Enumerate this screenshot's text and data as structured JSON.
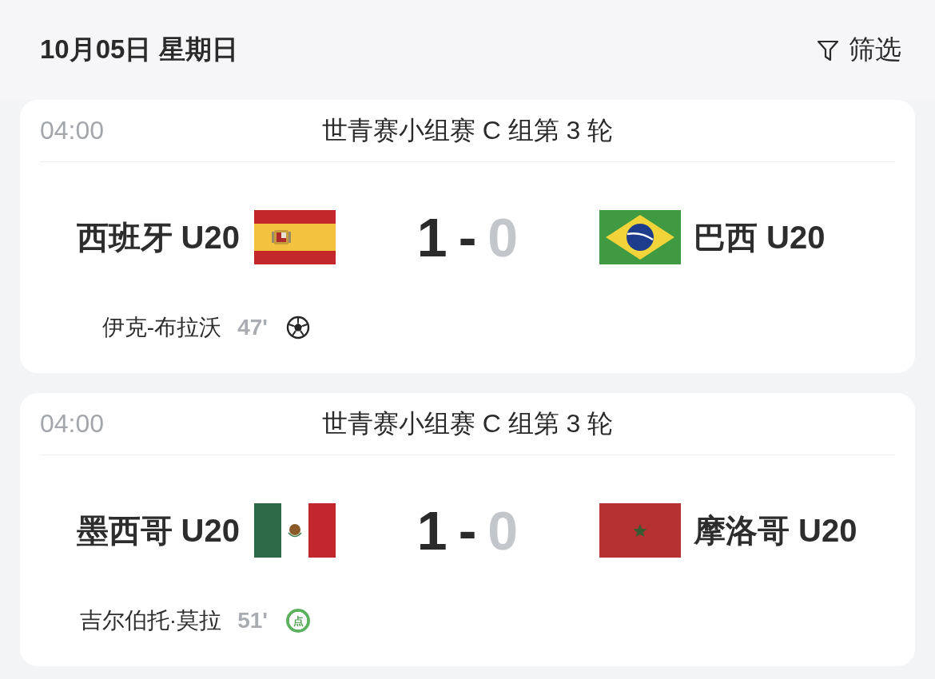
{
  "header": {
    "date": "10月05日 星期日",
    "filter": {
      "label": "筛选"
    }
  },
  "matches": [
    {
      "time": "04:00",
      "round": "世青赛小组赛 C 组第 3 轮",
      "home": {
        "name": "西班牙 U20",
        "flag": {
          "kind": "spain"
        },
        "score": "1",
        "score_highlighted": true
      },
      "separator": "-",
      "away": {
        "name": "巴西 U20",
        "flag": {
          "kind": "brazil"
        },
        "score": "0",
        "score_highlighted": false
      },
      "events": [
        {
          "player": "伊克-布拉沃",
          "minute": "47'",
          "kind": "goal"
        }
      ]
    },
    {
      "time": "04:00",
      "round": "世青赛小组赛 C 组第 3 轮",
      "home": {
        "name": "墨西哥 U20",
        "flag": {
          "kind": "mexico"
        },
        "score": "1",
        "score_highlighted": true
      },
      "separator": "-",
      "away": {
        "name": "摩洛哥 U20",
        "flag": {
          "kind": "morocco"
        },
        "score": "0",
        "score_highlighted": false
      },
      "events": [
        {
          "player": "吉尔伯托·莫拉",
          "minute": "51'",
          "kind": "penalty",
          "badge": "点"
        }
      ]
    }
  ]
}
